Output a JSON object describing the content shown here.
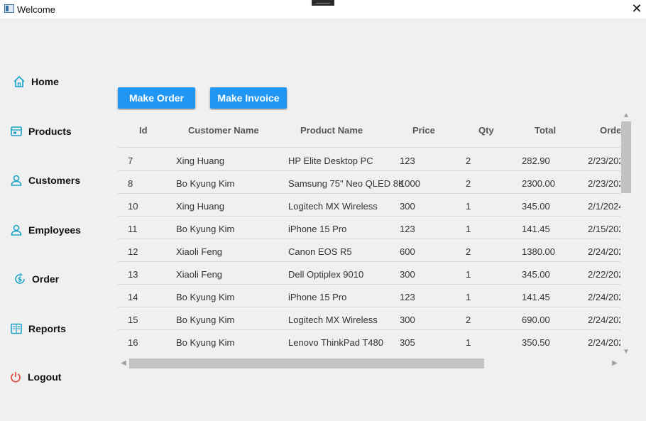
{
  "window": {
    "title": "Welcome",
    "close_glyph": "✕"
  },
  "sidebar": {
    "items": [
      {
        "label": "Home",
        "icon": "home-icon"
      },
      {
        "label": "Products",
        "icon": "products-icon"
      },
      {
        "label": "Customers",
        "icon": "customers-icon"
      },
      {
        "label": "Employees",
        "icon": "employees-icon"
      },
      {
        "label": "Order",
        "icon": "order-icon"
      },
      {
        "label": "Reports",
        "icon": "reports-icon"
      },
      {
        "label": "Logout",
        "icon": "power-icon"
      }
    ]
  },
  "toolbar": {
    "make_order_label": "Make Order",
    "make_invoice_label": "Make Invoice"
  },
  "table": {
    "headers": [
      "Id",
      "Customer Name",
      "Product Name",
      "Price",
      "Qty",
      "Total",
      "Order"
    ],
    "rows": [
      [
        "7",
        "Xing Huang",
        "HP Elite Desktop PC",
        "123",
        "2",
        "282.90",
        "2/23/202"
      ],
      [
        "8",
        "Bo Kyung Kim",
        "Samsung 75\" Neo QLED 8K",
        "1000",
        "2",
        "2300.00",
        "2/23/202"
      ],
      [
        "10",
        "Xing Huang",
        "Logitech MX Wireless",
        "300",
        "1",
        "345.00",
        "2/1/2024"
      ],
      [
        "11",
        "Bo Kyung Kim",
        "iPhone 15 Pro",
        "123",
        "1",
        "141.45",
        "2/15/202"
      ],
      [
        "12",
        "Xiaoli Feng",
        "Canon EOS R5",
        "600",
        "2",
        "1380.00",
        "2/24/202"
      ],
      [
        "13",
        "Xiaoli Feng",
        "Dell Optiplex 9010",
        "300",
        "1",
        "345.00",
        "2/22/202"
      ],
      [
        "14",
        "Bo Kyung Kim",
        "iPhone 15 Pro",
        "123",
        "1",
        "141.45",
        "2/24/202"
      ],
      [
        "15",
        "Bo Kyung Kim",
        "Logitech MX Wireless",
        "300",
        "2",
        "690.00",
        "2/24/202"
      ],
      [
        "16",
        "Bo Kyung Kim",
        "Lenovo ThinkPad T480",
        "305",
        "1",
        "350.50",
        "2/24/202"
      ]
    ]
  },
  "scroll": {
    "vertical_position": 0.0,
    "vertical_visible_fraction": 0.32,
    "horizontal_position": 0.0,
    "horizontal_visible_fraction": 0.74
  },
  "colors": {
    "accent": "#2196f3",
    "icon_teal": "#1aa3c8",
    "logout_red": "#e0483e"
  }
}
